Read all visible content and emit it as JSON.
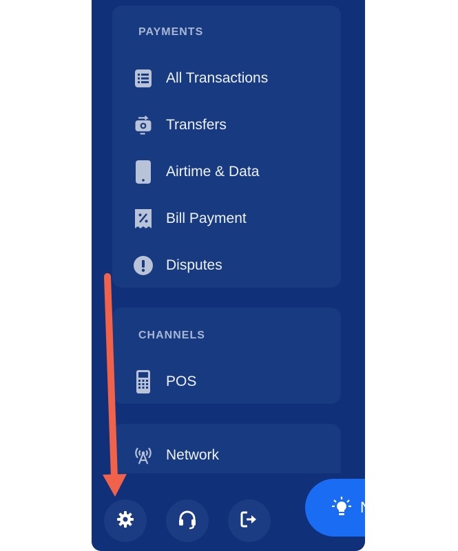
{
  "payments": {
    "title": "PAYMENTS",
    "items": [
      {
        "label": "All Transactions",
        "icon": "list-icon"
      },
      {
        "label": "Transfers",
        "icon": "transfer-icon"
      },
      {
        "label": "Airtime & Data",
        "icon": "phone-icon"
      },
      {
        "label": "Bill Payment",
        "icon": "receipt-icon"
      },
      {
        "label": "Disputes",
        "icon": "exclamation-icon"
      }
    ]
  },
  "channels": {
    "title": "CHANNELS",
    "items": [
      {
        "label": "POS",
        "icon": "pos-terminal-icon"
      }
    ]
  },
  "network": {
    "label": "Network",
    "icon": "antenna-icon"
  },
  "bottom": {
    "settings_icon": "gear-icon",
    "support_icon": "headset-icon",
    "logout_icon": "logout-icon",
    "tip_label": "N"
  },
  "colors": {
    "sidebar": "#10307a",
    "card": "#173a80",
    "accent": "#1a6cf2",
    "annotation_arrow": "#f0624a"
  }
}
